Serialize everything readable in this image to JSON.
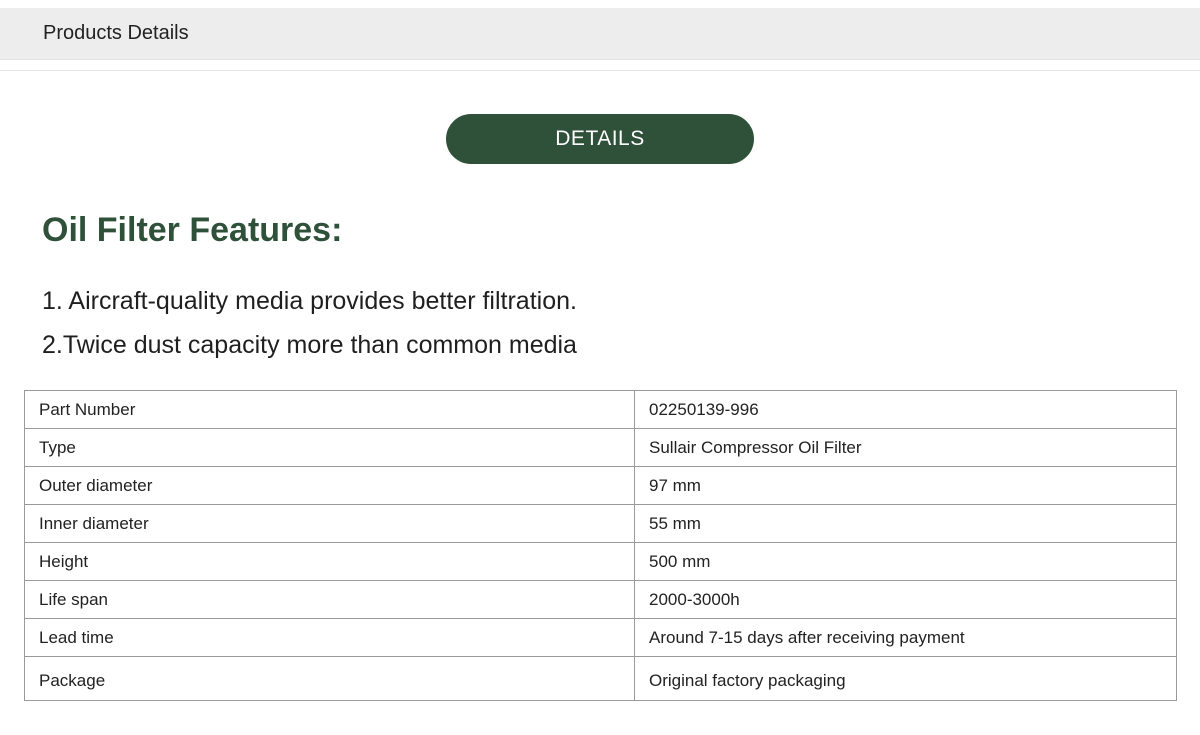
{
  "header": {
    "tab_label": "Products Details"
  },
  "details_button": {
    "label": "DETAILS"
  },
  "section": {
    "title": "Oil Filter Features:",
    "features": [
      "1. Aircraft-quality media provides better filtration.",
      "2.Twice dust capacity more than common media"
    ]
  },
  "specs": {
    "rows": [
      {
        "label": "Part Number",
        "value": "02250139-996"
      },
      {
        "label": "Type",
        "value": "Sullair Compressor Oil Filter"
      },
      {
        "label": "Outer diameter",
        "value": "97 mm"
      },
      {
        "label": "Inner diameter",
        "value": "55 mm"
      },
      {
        "label": "Height",
        "value": "500 mm"
      },
      {
        "label": "Life span",
        "value": "2000-3000h"
      },
      {
        "label": "Lead time",
        "value": "Around 7-15 days after receiving payment"
      },
      {
        "label": "Package",
        "value": "Original factory packaging"
      }
    ]
  },
  "colors": {
    "accent": "#2f513a",
    "tab_background": "#ededed",
    "table_border": "#9a9a9a"
  }
}
